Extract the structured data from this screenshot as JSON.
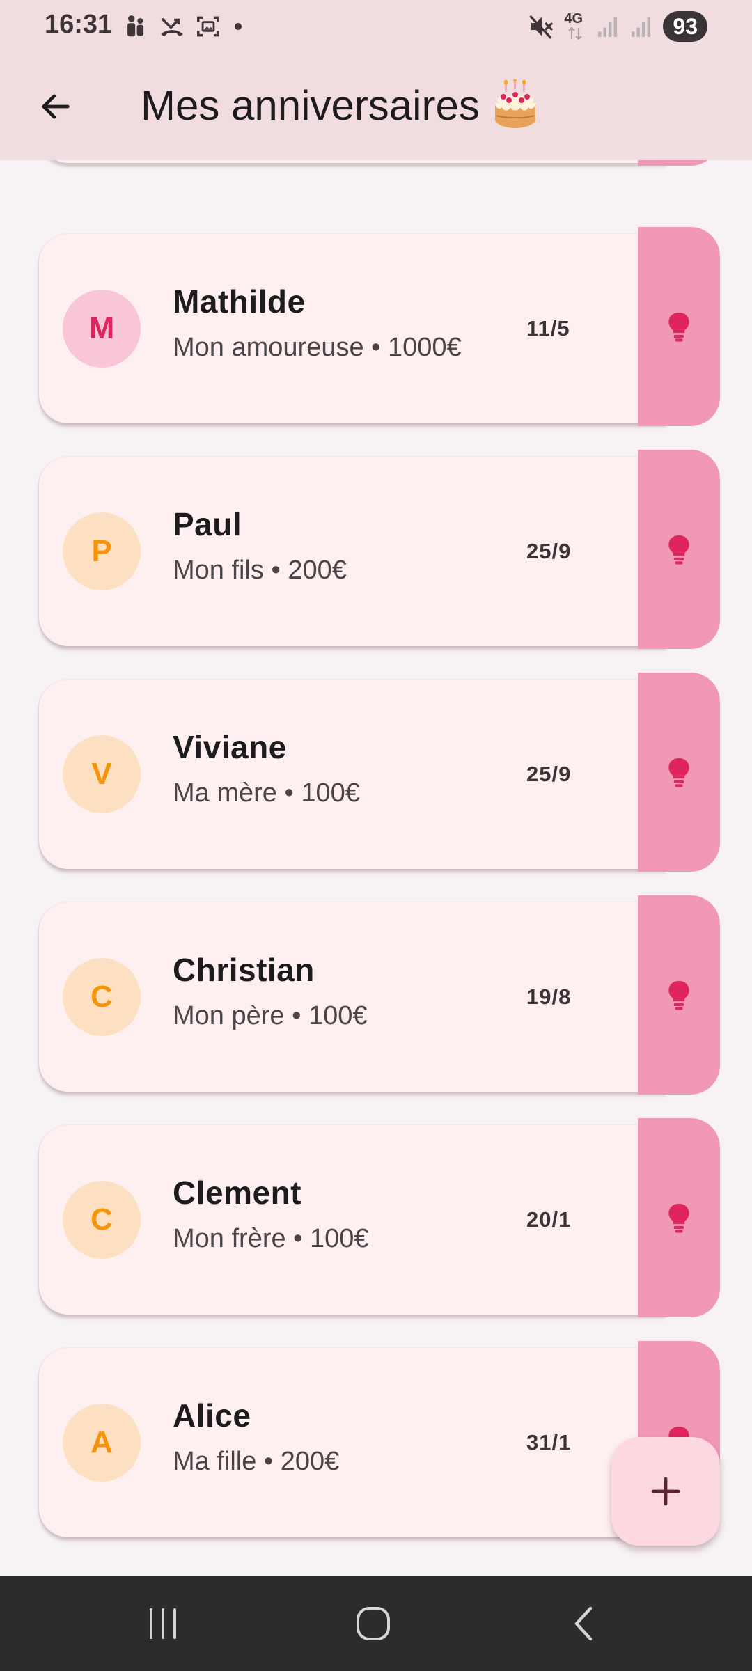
{
  "status_bar": {
    "time": "16:31",
    "network": "4G",
    "battery": "93",
    "left_icons": [
      "people-icon",
      "missed-call-icon",
      "screenshot-icon",
      "dot-icon"
    ],
    "right_icons": [
      "mute-icon",
      "network-4g-icon",
      "signal-icon",
      "signal-icon"
    ]
  },
  "app_bar": {
    "back_icon": "arrow-back-icon",
    "title": "Mes anniversaires",
    "title_emoji_icon": "birthday-cake-icon"
  },
  "colors": {
    "app_bar_bg": "#f1dde0",
    "card_bg": "#fef0f1",
    "card_side": "#f298b7",
    "accent_pink": "#e0245e",
    "accent_orange": "#f5940a",
    "fab_bg": "#fcd9e0"
  },
  "birthdays": [
    {
      "initial": "M",
      "name": "Mathilde",
      "subtitle": "Mon amoureuse • 1000€",
      "date": "11/5",
      "avatar_color": "pink",
      "action_icon": "lightbulb-icon"
    },
    {
      "initial": "P",
      "name": "Paul",
      "subtitle": "Mon fils • 200€",
      "date": "25/9",
      "avatar_color": "orange",
      "action_icon": "lightbulb-icon"
    },
    {
      "initial": "V",
      "name": "Viviane",
      "subtitle": "Ma mère • 100€",
      "date": "25/9",
      "avatar_color": "orange",
      "action_icon": "lightbulb-icon"
    },
    {
      "initial": "C",
      "name": "Christian",
      "subtitle": "Mon père • 100€",
      "date": "19/8",
      "avatar_color": "orange",
      "action_icon": "lightbulb-icon"
    },
    {
      "initial": "C",
      "name": "Clement",
      "subtitle": "Mon frère • 100€",
      "date": "20/1",
      "avatar_color": "orange",
      "action_icon": "lightbulb-icon"
    },
    {
      "initial": "A",
      "name": "Alice",
      "subtitle": "Ma fille • 200€",
      "date": "31/1",
      "avatar_color": "orange",
      "action_icon": "lightbulb-icon"
    }
  ],
  "fab": {
    "icon": "add-icon"
  },
  "nav_bar": {
    "icons": [
      "recent-apps-icon",
      "home-icon",
      "back-icon"
    ]
  }
}
